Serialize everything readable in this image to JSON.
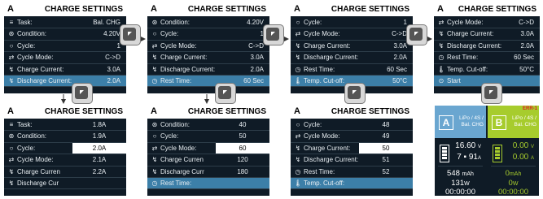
{
  "title": "CHARGE SETTINGS",
  "brand": "A",
  "screen1": [
    {
      "icon": "≡",
      "label": "Task:",
      "value": "Bal. CHG"
    },
    {
      "icon": "⊛",
      "label": "Condition:",
      "value": "4.20V"
    },
    {
      "icon": "○",
      "label": "Cycle:",
      "value": "1"
    },
    {
      "icon": "⇄",
      "label": "Cycle Mode:",
      "value": "C->D"
    },
    {
      "icon": "↯",
      "label": "Charge Current:",
      "value": "3.0A"
    },
    {
      "icon": "↯",
      "label": "Discharge Current:",
      "value": "2.0A"
    }
  ],
  "screen2": [
    {
      "icon": "⊛",
      "label": "Condition:",
      "value": "4.20V"
    },
    {
      "icon": "○",
      "label": "Cycle:",
      "value": "1"
    },
    {
      "icon": "⇄",
      "label": "Cycle Mode:",
      "value": "C->D"
    },
    {
      "icon": "↯",
      "label": "Charge Current:",
      "value": "3.0A"
    },
    {
      "icon": "↯",
      "label": "Discharge Current:",
      "value": "2.0A"
    },
    {
      "icon": "◷",
      "label": "Rest Time:",
      "value": "60 Sec"
    }
  ],
  "screen3": [
    {
      "icon": "○",
      "label": "Cycle:",
      "value": "1"
    },
    {
      "icon": "⇄",
      "label": "Cycle Mode:",
      "value": "C->D"
    },
    {
      "icon": "↯",
      "label": "Charge Current:",
      "value": "3.0A"
    },
    {
      "icon": "↯",
      "label": "Discharge Current:",
      "value": "2.0A"
    },
    {
      "icon": "◷",
      "label": "Rest Time:",
      "value": "60 Sec"
    },
    {
      "icon": "🌡",
      "label": "Temp. Cut-off:",
      "value": "50°C"
    }
  ],
  "screen4": [
    {
      "icon": "⇄",
      "label": "Cycle Mode:",
      "value": "C->D"
    },
    {
      "icon": "↯",
      "label": "Charge Current:",
      "value": "3.0A"
    },
    {
      "icon": "↯",
      "label": "Discharge Current:",
      "value": "2.0A"
    },
    {
      "icon": "◷",
      "label": "Rest Time:",
      "value": "60 Sec"
    },
    {
      "icon": "🌡",
      "label": "Temp. Cut-off:",
      "value": "50°C"
    },
    {
      "icon": "⊙",
      "label": "Start",
      "value": ""
    }
  ],
  "screen5": {
    "labels": [
      {
        "icon": "≡",
        "label": "Task:"
      },
      {
        "icon": "⊛",
        "label": "Condition:"
      },
      {
        "icon": "○",
        "label": "Cycle:"
      },
      {
        "icon": "⇄",
        "label": "Cycle Mode:"
      },
      {
        "icon": "↯",
        "label": "Charge Curren"
      },
      {
        "icon": "↯",
        "label": "Discharge Cur"
      }
    ],
    "options": [
      "1.8A",
      "1.9A",
      "2.0A",
      "2.1A",
      "2.2A"
    ]
  },
  "screen6": {
    "labels": [
      {
        "icon": "⊛",
        "label": "Condition:"
      },
      {
        "icon": "○",
        "label": "Cycle:"
      },
      {
        "icon": "⇄",
        "label": "Cycle Mode:"
      },
      {
        "icon": "↯",
        "label": "Charge Curren"
      },
      {
        "icon": "↯",
        "label": "Discharge Curr"
      },
      {
        "icon": "◷",
        "label": "Rest Time:"
      }
    ],
    "options": [
      "40",
      "50",
      "60",
      "120",
      "180"
    ]
  },
  "screen7": {
    "labels": [
      {
        "icon": "○",
        "label": "Cycle:"
      },
      {
        "icon": "⇄",
        "label": "Cycle Mode:"
      },
      {
        "icon": "↯",
        "label": "Charge Current:"
      },
      {
        "icon": "↯",
        "label": "Discharge Current:"
      },
      {
        "icon": "◷",
        "label": "Rest Time:"
      },
      {
        "icon": "🌡",
        "label": "Temp. Cut-off:"
      }
    ],
    "options": [
      "48",
      "49",
      "50",
      "51",
      "52"
    ]
  },
  "info": {
    "a": {
      "badge": "A",
      "line1": "LiPo / 4S /",
      "line2": "Bal. CHG",
      "volt": "16.60",
      "volt_unit": "V",
      "curr": "7 ▪ 91",
      "curr_unit": "A",
      "mah": "548",
      "mah_unit": "mAh",
      "watt": "131",
      "watt_unit": "W",
      "time": "00:00:00"
    },
    "b": {
      "badge": "B",
      "warn": "ERR-1",
      "line1": "LiPo / 4S /",
      "line2": "Bal. CHG",
      "volt": "0.00",
      "volt_unit": "V",
      "curr": "0.00",
      "curr_unit": "A",
      "mah": "0",
      "mah_unit": "mAh",
      "watt": "0",
      "watt_unit": "W",
      "time": "00:00:00"
    }
  },
  "colors": {
    "screen_bg": "#0f1b26",
    "selected": "#3c7fa8",
    "slot_a": "#6aa6d0",
    "slot_b": "#a7cc2d"
  }
}
